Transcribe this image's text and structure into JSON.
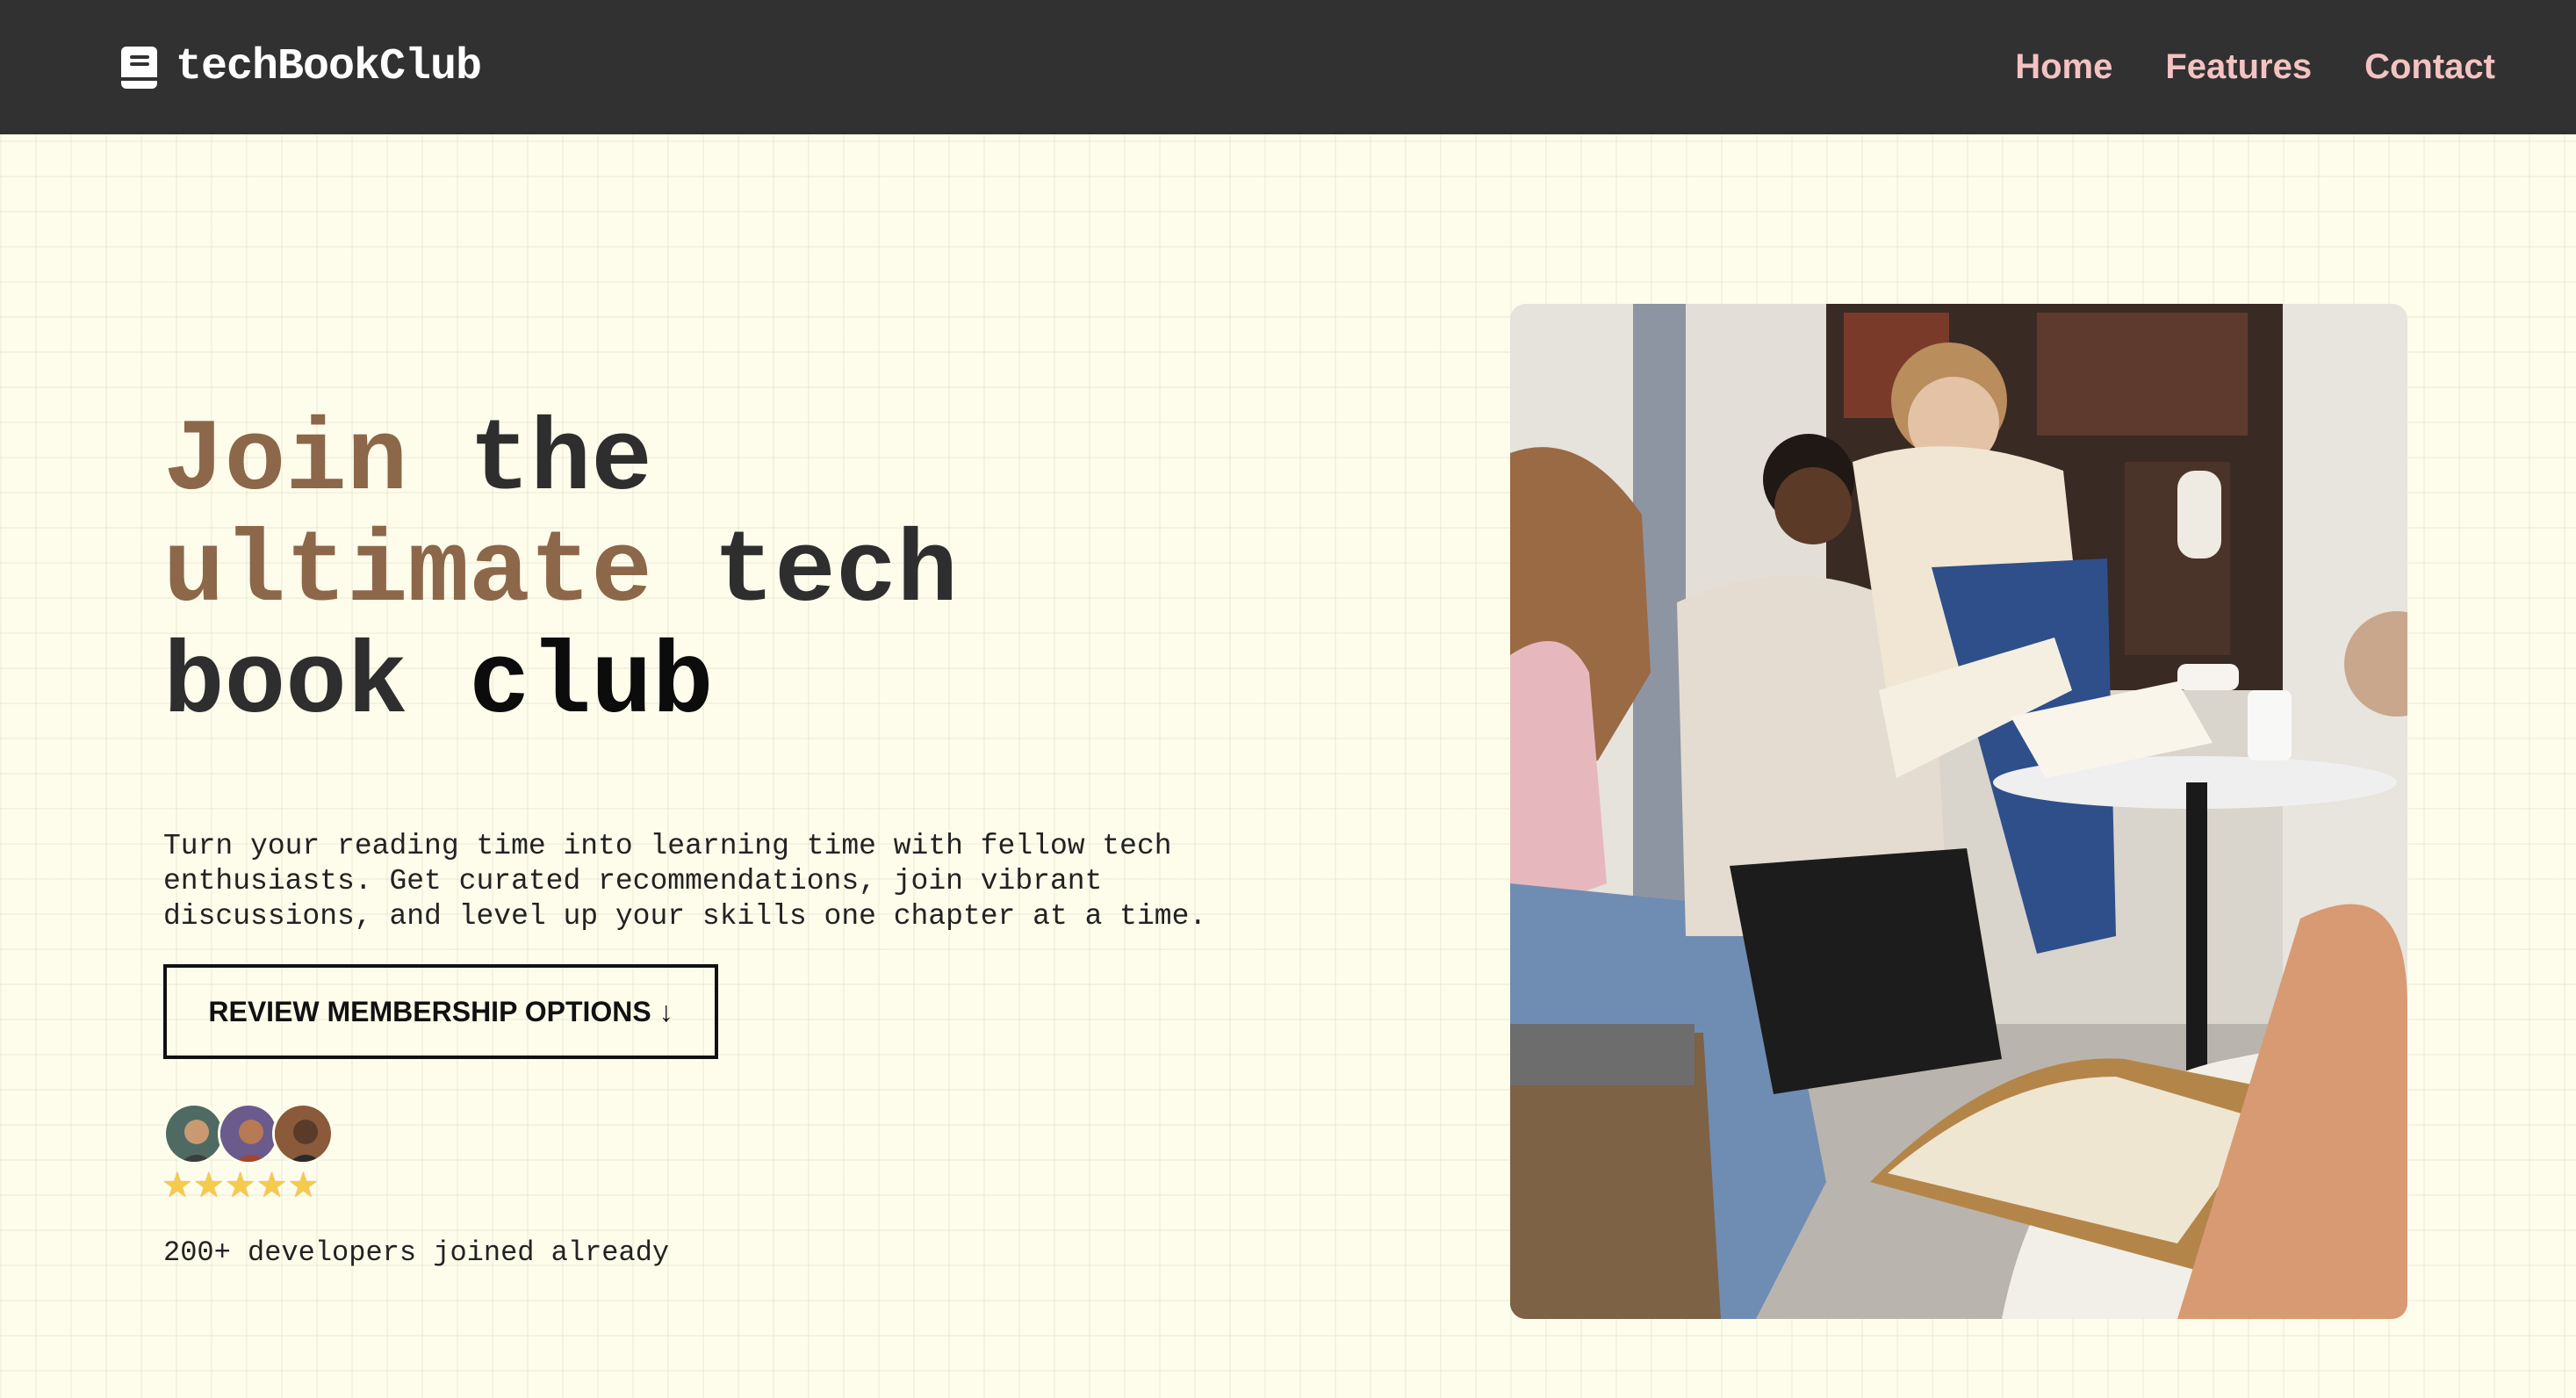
{
  "nav": {
    "brand": "techBookClub",
    "brand_icon": "book-icon",
    "links": [
      "Home",
      "Features",
      "Contact"
    ]
  },
  "hero": {
    "headline_parts": [
      "Join",
      "the",
      "ultimate",
      "tech",
      "book",
      "club"
    ],
    "subtext": "Turn your reading time into learning time with fellow tech enthusiasts. Get curated recommendations, join vibrant discussions, and level up your skills one chapter at a time.",
    "cta_label": "REVIEW MEMBERSHIP OPTIONS ↓",
    "rating_stars": 5,
    "joined_text": "200+ developers joined already"
  },
  "colors": {
    "navbar": "#313131",
    "background": "#fefdec",
    "nav_link": "#f4c2c2",
    "accent_brown": "#8c6749"
  }
}
